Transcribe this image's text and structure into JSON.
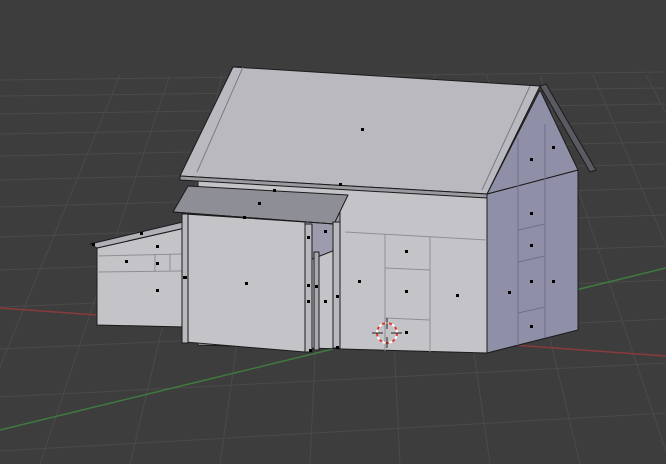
{
  "app": {
    "view": "3d-viewport",
    "mode": "edit-mode"
  },
  "colors": {
    "background": "#3d3d3d",
    "grid": "#4a4a4a",
    "axis_x": "#8a3a3a",
    "axis_y": "#3f7a3f",
    "face_light": "#c4c4c8",
    "face_mid": "#adadb4",
    "face_dark": "#8f90a8",
    "roof": "#b9b9bf",
    "edge": "#1b1b1b",
    "face_dot": "#000000",
    "cursor_red": "#e23a2a",
    "cursor_white": "#ffffff"
  },
  "icons": {
    "cursor": "3d-cursor-icon"
  }
}
